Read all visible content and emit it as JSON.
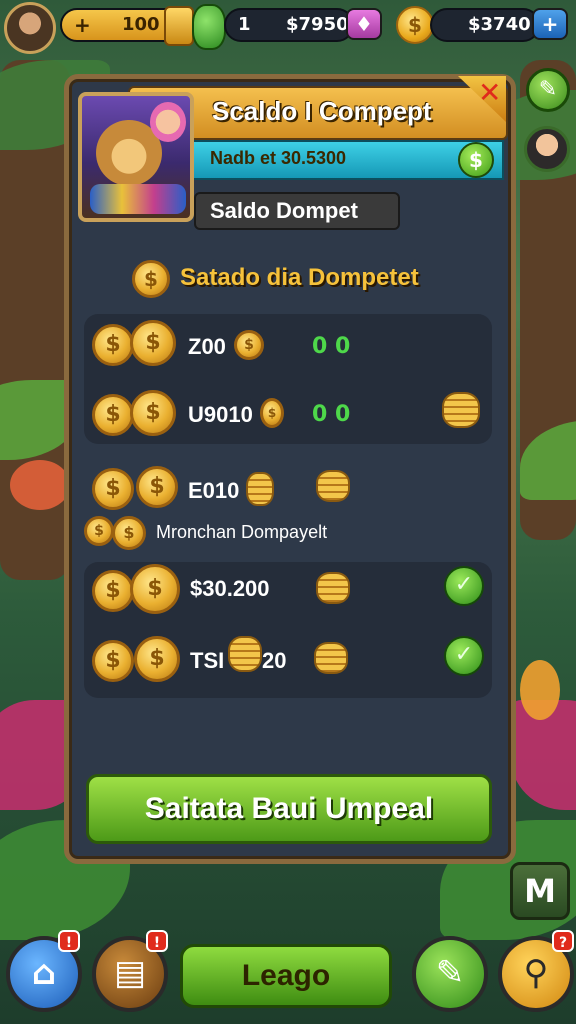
{
  "hud": {
    "gold_value": "100",
    "gem_count": "1",
    "cash1": "$7950",
    "cash2": "$3740",
    "plus_icon": "+"
  },
  "panel": {
    "title": "Scaldo I Compept",
    "cyan_text": "Nadb et 30.5300",
    "dollar_symbol": "$",
    "subtab": "Saldo Dompet",
    "section_title": "Satado dia Dompetet",
    "group1": [
      {
        "amount": "Z00",
        "green": "0 0"
      },
      {
        "amount": "U9010",
        "green": "0 0"
      }
    ],
    "row3_amount": "E010",
    "mid_label": "Mronchan Dompayelt",
    "group2": [
      {
        "amount": "$30.200"
      },
      {
        "amount": "TSI",
        "extra": "20"
      }
    ],
    "main_button": "Saitata Baui Umpeal"
  },
  "side": {
    "m_label": "M"
  },
  "bottom": {
    "leago": "Leago",
    "badge1": "!",
    "badge2": "!",
    "badge3": "?"
  },
  "colors": {
    "panel_bg": "#2e3949",
    "gold": "#f6c23b",
    "green_button": "#6fb92c",
    "cyan": "#2ab8d2"
  }
}
